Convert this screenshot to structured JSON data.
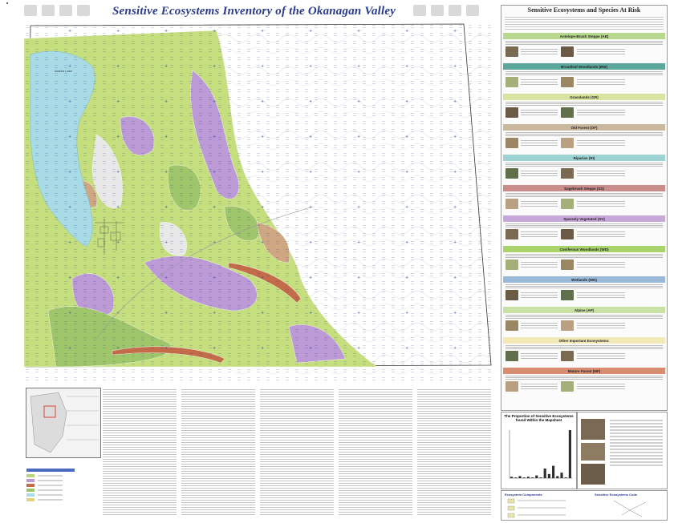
{
  "header": {
    "title": "Sensitive Ecosystems Inventory of the Okanagan Valley"
  },
  "map": {
    "lake_label": "Alaska Lake",
    "colors": {
      "lake": "#a9dbe6",
      "grassland": "#c5de7e",
      "forest": "#bb9ad6",
      "coniferous": "#9fc66a",
      "riparian": "#c46b4a",
      "brown": "#cfa883",
      "pale": "#e8e8e8"
    }
  },
  "panel": {
    "title": "Sensitive Ecosystems and Species At Risk",
    "ecosystems": [
      {
        "name": "Antelope-Brush Steppe (AB)",
        "color": "#b7d88d"
      },
      {
        "name": "Broadleaf Woodlands (BW)",
        "color": "#5ba79b"
      },
      {
        "name": "Grasslands (GR)",
        "color": "#d7e5a0"
      },
      {
        "name": "Old Forest (OF)",
        "color": "#c9b79e"
      },
      {
        "name": "Riparian (RI)",
        "color": "#9dd3d2"
      },
      {
        "name": "Sagebrush Steppe (SS)",
        "color": "#c98c8a"
      },
      {
        "name": "Sparsely Vegetated (SV)",
        "color": "#c7a9d9"
      },
      {
        "name": "Coniferous Woodlands (WD)",
        "color": "#a9d36b"
      },
      {
        "name": "Wetlands (WN)",
        "color": "#9ab8d8"
      },
      {
        "name": "Alpine (AP)",
        "color": "#c9e1a5"
      },
      {
        "name": "Other Important Ecosystems:",
        "color": "#f2e8b8"
      },
      {
        "name": "Mature Forest (MF)",
        "color": "#d88d73"
      }
    ]
  },
  "chart": {
    "title": "The Proportion of Sensitive Ecosystems found Within the Mapsheet",
    "chart_data": {
      "type": "bar",
      "values": [
        2,
        1,
        3,
        1,
        2,
        1,
        4,
        1,
        14,
        6,
        18,
        3,
        8,
        1,
        70
      ]
    }
  },
  "lower": {
    "legend_title": "Ecosystem Components",
    "key_title": "Sensitive Ecosystems Code"
  }
}
